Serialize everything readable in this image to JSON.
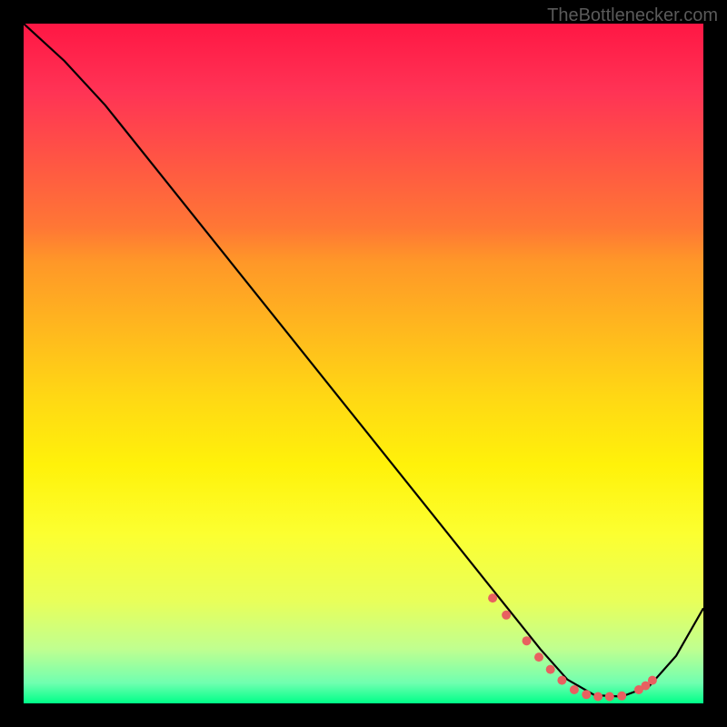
{
  "watermark": "TheBottlenecker.com",
  "chart_data": {
    "type": "line",
    "title": "",
    "xlabel": "",
    "ylabel": "",
    "xlim": [
      0,
      1
    ],
    "ylim": [
      0,
      1
    ],
    "curve": {
      "x": [
        0.0,
        0.06,
        0.12,
        0.2,
        0.3,
        0.4,
        0.5,
        0.6,
        0.68,
        0.72,
        0.76,
        0.8,
        0.84,
        0.88,
        0.92,
        0.96,
        1.0
      ],
      "y": [
        1.0,
        0.945,
        0.88,
        0.78,
        0.655,
        0.53,
        0.405,
        0.28,
        0.18,
        0.13,
        0.08,
        0.035,
        0.012,
        0.01,
        0.025,
        0.07,
        0.14
      ]
    },
    "markers": {
      "x": [
        0.69,
        0.71,
        0.74,
        0.758,
        0.775,
        0.792,
        0.81,
        0.828,
        0.845,
        0.862,
        0.88,
        0.905,
        0.915,
        0.925
      ],
      "y": [
        0.155,
        0.13,
        0.092,
        0.068,
        0.05,
        0.034,
        0.02,
        0.013,
        0.01,
        0.01,
        0.011,
        0.02,
        0.026,
        0.034
      ]
    },
    "colors": {
      "curve": "#000000",
      "markers": "#e86060",
      "gradient_top": "#ff1744",
      "gradient_bottom": "#00ff88"
    }
  }
}
